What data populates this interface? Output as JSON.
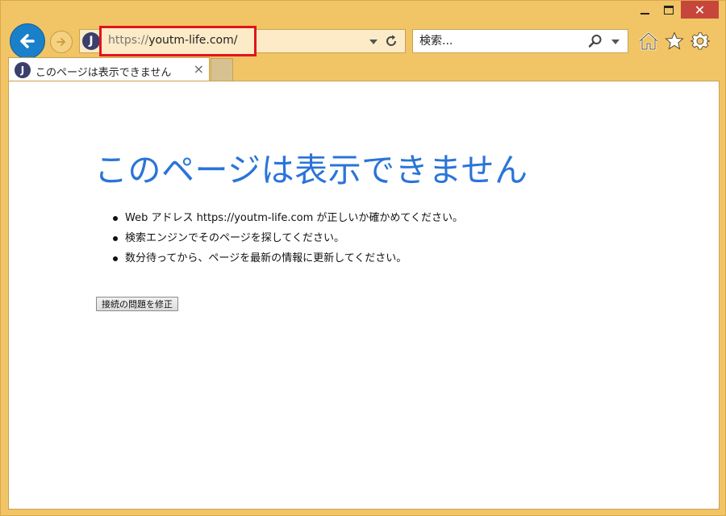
{
  "browser": {
    "address": {
      "scheme": "https://",
      "host": "youtm-life.com/"
    },
    "search": {
      "placeholder": "検索..."
    },
    "tab": {
      "favicon_letter": "J",
      "title": "このページは表示できません",
      "close_glyph": "×"
    },
    "site_favicon_letter": "J",
    "window_controls": {
      "close_glyph": "✕"
    },
    "colors": {
      "frame": "#f1c466",
      "accent_blue": "#2a74d8",
      "highlight": "#e0141c",
      "close_red": "#c7463b"
    }
  },
  "page": {
    "title": "このページは表示できません",
    "bullets": [
      "Web アドレス https://youtm-life.com が正しいか確かめてください。",
      "検索エンジンでそのページを探してください。",
      "数分待ってから、ページを最新の情報に更新してください。"
    ],
    "fix_button": "接続の問題を修正"
  }
}
